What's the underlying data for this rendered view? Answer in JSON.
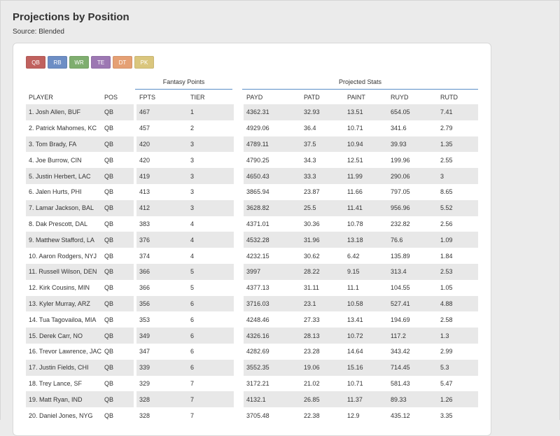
{
  "page": {
    "title": "Projections by Position",
    "source": "Source: Blended"
  },
  "positions": [
    {
      "label": "QB",
      "color": "#c0615e"
    },
    {
      "label": "RB",
      "color": "#6d8ec5"
    },
    {
      "label": "WR",
      "color": "#7fae6f"
    },
    {
      "label": "TE",
      "color": "#9d78b3"
    },
    {
      "label": "DT",
      "color": "#e5a074"
    },
    {
      "label": "PK",
      "color": "#dac67d"
    }
  ],
  "groups": {
    "fantasy_points": "Fantasy Points",
    "projected_stats": "Projected Stats"
  },
  "columns": [
    "PLAYER",
    "POS",
    "FPTS",
    "TIER",
    "PAYD",
    "PATD",
    "PAINT",
    "RUYD",
    "RUTD"
  ],
  "rows": [
    [
      "1. Josh Allen, BUF",
      "QB",
      "467",
      "1",
      "4362.31",
      "32.93",
      "13.51",
      "654.05",
      "7.41"
    ],
    [
      "2. Patrick Mahomes, KC",
      "QB",
      "457",
      "2",
      "4929.06",
      "36.4",
      "10.71",
      "341.6",
      "2.79"
    ],
    [
      "3. Tom Brady, FA",
      "QB",
      "420",
      "3",
      "4789.11",
      "37.5",
      "10.94",
      "39.93",
      "1.35"
    ],
    [
      "4. Joe Burrow, CIN",
      "QB",
      "420",
      "3",
      "4790.25",
      "34.3",
      "12.51",
      "199.96",
      "2.55"
    ],
    [
      "5. Justin Herbert, LAC",
      "QB",
      "419",
      "3",
      "4650.43",
      "33.3",
      "11.99",
      "290.06",
      "3"
    ],
    [
      "6. Jalen Hurts, PHI",
      "QB",
      "413",
      "3",
      "3865.94",
      "23.87",
      "11.66",
      "797.05",
      "8.65"
    ],
    [
      "7. Lamar Jackson, BAL",
      "QB",
      "412",
      "3",
      "3628.82",
      "25.5",
      "11.41",
      "956.96",
      "5.52"
    ],
    [
      "8. Dak Prescott, DAL",
      "QB",
      "383",
      "4",
      "4371.01",
      "30.36",
      "10.78",
      "232.82",
      "2.56"
    ],
    [
      "9. Matthew Stafford, LA",
      "QB",
      "376",
      "4",
      "4532.28",
      "31.96",
      "13.18",
      "76.6",
      "1.09"
    ],
    [
      "10. Aaron Rodgers, NYJ",
      "QB",
      "374",
      "4",
      "4232.15",
      "30.62",
      "6.42",
      "135.89",
      "1.84"
    ],
    [
      "11. Russell Wilson, DEN",
      "QB",
      "366",
      "5",
      "3997",
      "28.22",
      "9.15",
      "313.4",
      "2.53"
    ],
    [
      "12. Kirk Cousins, MIN",
      "QB",
      "366",
      "5",
      "4377.13",
      "31.11",
      "11.1",
      "104.55",
      "1.05"
    ],
    [
      "13. Kyler Murray, ARZ",
      "QB",
      "356",
      "6",
      "3716.03",
      "23.1",
      "10.58",
      "527.41",
      "4.88"
    ],
    [
      "14. Tua Tagovailoa, MIA",
      "QB",
      "353",
      "6",
      "4248.46",
      "27.33",
      "13.41",
      "194.69",
      "2.58"
    ],
    [
      "15. Derek Carr, NO",
      "QB",
      "349",
      "6",
      "4326.16",
      "28.13",
      "10.72",
      "117.2",
      "1.3"
    ],
    [
      "16. Trevor Lawrence, JAC",
      "QB",
      "347",
      "6",
      "4282.69",
      "23.28",
      "14.64",
      "343.42",
      "2.99"
    ],
    [
      "17. Justin Fields, CHI",
      "QB",
      "339",
      "6",
      "3552.35",
      "19.06",
      "15.16",
      "714.45",
      "5.3"
    ],
    [
      "18. Trey Lance, SF",
      "QB",
      "329",
      "7",
      "3172.21",
      "21.02",
      "10.71",
      "581.43",
      "5.47"
    ],
    [
      "19. Matt Ryan, IND",
      "QB",
      "328",
      "7",
      "4132.1",
      "26.85",
      "11.37",
      "89.33",
      "1.26"
    ],
    [
      "20. Daniel Jones, NYG",
      "QB",
      "328",
      "7",
      "3705.48",
      "22.38",
      "12.9",
      "435.12",
      "3.35"
    ]
  ]
}
